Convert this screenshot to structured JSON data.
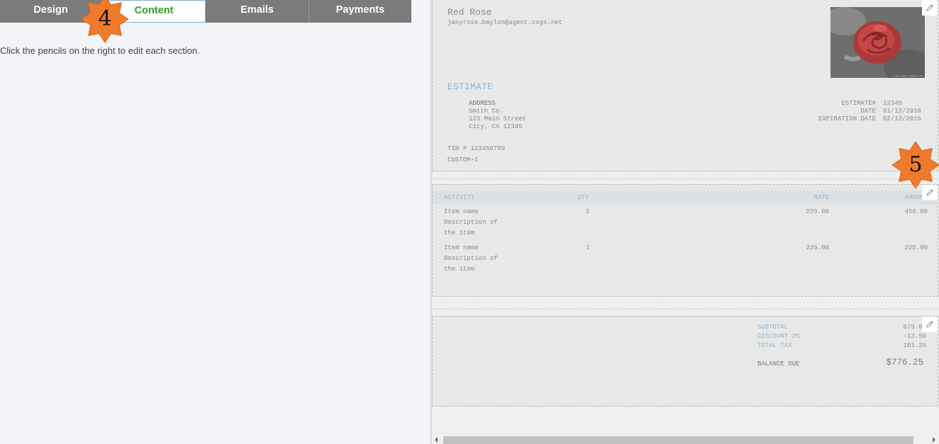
{
  "tabs": [
    {
      "label": "Design"
    },
    {
      "label": "Content"
    },
    {
      "label": "Emails"
    },
    {
      "label": "Payments"
    }
  ],
  "active_tab": "Content",
  "instruction": "Click the pencils on the right to edit each section.",
  "callouts": {
    "first": "4",
    "second": "5"
  },
  "colors": {
    "tab_bar": "#7b7b7b",
    "active_tab_text": "#2ca01c",
    "callout_fill": "#ef7a2c",
    "preview_heading": "#8fb4cc"
  },
  "icons": {
    "edit": "pencil-icon",
    "scroll_left": "triangle-left",
    "scroll_right": "triangle-right"
  },
  "preview": {
    "company": {
      "name": "Red Rose",
      "email": "janyrose.baylon@agent.cvgs.net",
      "logo_caption": "© www.sample-photos.com"
    },
    "title": "ESTIMATE",
    "address": {
      "label": "ADDRESS",
      "lines": [
        "Smith Co.",
        "123 Main Street",
        "City, CA 12345"
      ]
    },
    "meta": [
      {
        "label": "ESTIMATE#",
        "value": "12345"
      },
      {
        "label": "DATE",
        "value": "01/12/2016"
      },
      {
        "label": "EXPIRATION DATE",
        "value": "02/12/2016"
      }
    ],
    "tin": "TIN # 123456789",
    "custom": "CUSTOM-1",
    "table": {
      "headers": {
        "activity": "ACTIVITY",
        "qty": "QTY",
        "rate": "RATE",
        "amount": "AMOUNT"
      },
      "rows": [
        {
          "activity": [
            "Item name",
            "Description of",
            "the item"
          ],
          "qty": "2",
          "rate": "225.00",
          "amount": "450.00"
        },
        {
          "activity": [
            "Item name",
            "Description of",
            "the item"
          ],
          "qty": "1",
          "rate": "225.00",
          "amount": "225.00"
        }
      ]
    },
    "totals": [
      {
        "label": "SUBTOTAL",
        "value": "675.00"
      },
      {
        "label": "DISCOUNT 2%",
        "value": "-13.50"
      },
      {
        "label": "TOTAL TAX",
        "value": "101.25"
      }
    ],
    "balance": {
      "label": "BALANCE DUE",
      "value": "$776.25"
    }
  }
}
